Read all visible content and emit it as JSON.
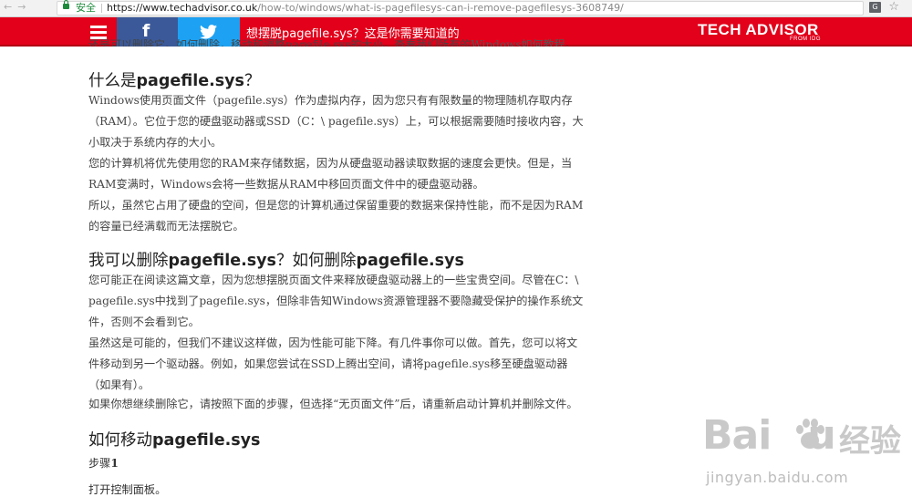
{
  "browser": {
    "secure_label": "安全",
    "url_host": "https://www.techadvisor.co.uk",
    "url_path": "/how-to/windows/what-is-pagefilesys-can-i-remove-pagefilesys-3608749/",
    "translate_icon_label": "G"
  },
  "header": {
    "facebook_label": "f",
    "title": "想摆脱pagefile.sys？这是你需要知道的",
    "logo": "TECH ADVISOR",
    "logo_sub": "FROM IDG",
    "brand_color": "#e2001a"
  },
  "article": {
    "clipped_prefix": "还是可以删除它。如何删除，移动和调整pagefile.sys的大小，查看我们所有的",
    "clipped_link": "Windows如何教程",
    "clipped_suffix": "。",
    "s1_heading_pre": "什么是",
    "s1_heading_bold": "pagefile.sys",
    "s1_heading_post": "？",
    "p1": "Windows使用页面文件（pagefile.sys）作为虚拟内存，因为您只有有限数量的物理随机存取内存（RAM）。它位于您的硬盘驱动器或SSD（C：\\ pagefile.sys）上，可以根据需要随时接收内容，大小取决于系统内存的大小。",
    "p2": "您的计算机将优先使用您的RAM来存储数据，因为从硬盘驱动器读取数据的速度会更快。但是，当RAM变满时，Windows会将一些数据从RAM中移回页面文件中的硬盘驱动器。",
    "p3": "所以，虽然它占用了硬盘的空间，但是您的计算机通过保留重要的数据来保持性能，而不是因为RAM的容量已经满载而无法摆脱它。",
    "s2_heading_pre": "我可以删除",
    "s2_heading_bold1": "pagefile.sys",
    "s2_heading_mid": "？如何删除",
    "s2_heading_bold2": "pagefile.sys",
    "p4": "您可能正在阅读这篇文章，因为您想摆脱页面文件来释放硬盘驱动器上的一些宝贵空间。尽管在C：\\ pagefile.sys中找到了pagefile.sys，但除非告知Windows资源管理器不要隐藏受保护的操作系统文件，否则不会看到它。",
    "p5": "虽然这是可能的，但我们不建议这样做，因为性能可能下降。有几件事你可以做。首先，您可以将文件移动到另一个驱动器。例如，如果您尝试在SSD上腾出空间，请将pagefile.sys移至硬盘驱动器（如果有）。",
    "p6": "如果你想继续删除它，请按照下面的步骤，但选择“无页面文件”后，请重新启动计算机并删除文件。",
    "s3_heading_pre": "如何移动",
    "s3_heading_bold": "pagefile.sys",
    "step_label": "步骤",
    "step_num": "1",
    "p7": "打开控制面板。"
  },
  "watermark": {
    "brand": "Bai",
    "brand_end": "u",
    "cn": "经验",
    "url": "jingyan.baidu.com"
  }
}
